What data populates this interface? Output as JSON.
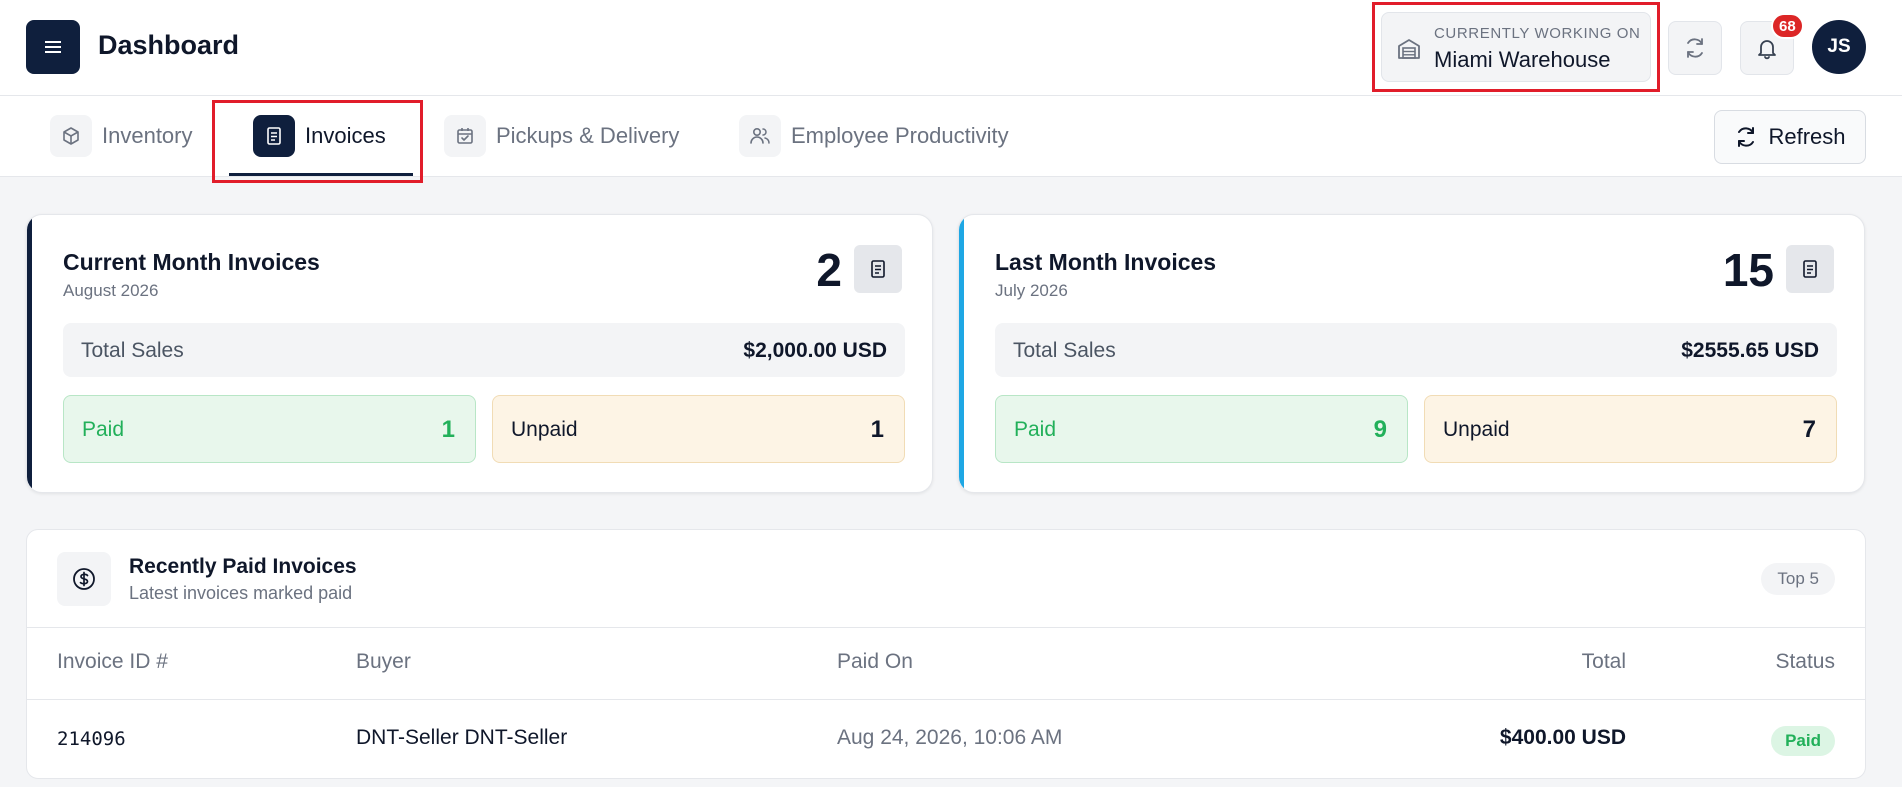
{
  "header": {
    "title": "Dashboard",
    "workspace_caption": "CURRENTLY WORKING ON",
    "workspace_name": "Miami Warehouse",
    "notification_count": "68",
    "user_initials": "JS"
  },
  "tabs": [
    {
      "label": "Inventory",
      "icon": "box-icon",
      "active": false
    },
    {
      "label": "Invoices",
      "icon": "invoice-icon",
      "active": true
    },
    {
      "label": "Pickups & Delivery",
      "icon": "calendar-check-icon",
      "active": false
    },
    {
      "label": "Employee Productivity",
      "icon": "users-icon",
      "active": false
    }
  ],
  "refresh_label": "Refresh",
  "cards": {
    "current": {
      "title": "Current Month Invoices",
      "period": "August 2026",
      "count": "2",
      "total_sales_label": "Total Sales",
      "total_sales": "$2,000.00 USD",
      "paid_label": "Paid",
      "paid": "1",
      "unpaid_label": "Unpaid",
      "unpaid": "1",
      "accent": "#0f1f3d"
    },
    "last": {
      "title": "Last Month Invoices",
      "period": "July 2026",
      "count": "15",
      "total_sales_label": "Total Sales",
      "total_sales": "$2555.65 USD",
      "paid_label": "Paid",
      "paid": "9",
      "unpaid_label": "Unpaid",
      "unpaid": "7",
      "accent": "#1ea7e4"
    }
  },
  "recent": {
    "title": "Recently Paid Invoices",
    "subtitle": "Latest invoices marked paid",
    "chip": "Top 5",
    "columns": [
      "Invoice ID #",
      "Buyer",
      "Paid On",
      "Total",
      "Status"
    ],
    "rows": [
      {
        "id": "214096",
        "buyer": "DNT-Seller DNT-Seller",
        "paid_on": "Aug 24, 2026, 10:06 AM",
        "total": "$400.00 USD",
        "status": "Paid"
      }
    ]
  }
}
